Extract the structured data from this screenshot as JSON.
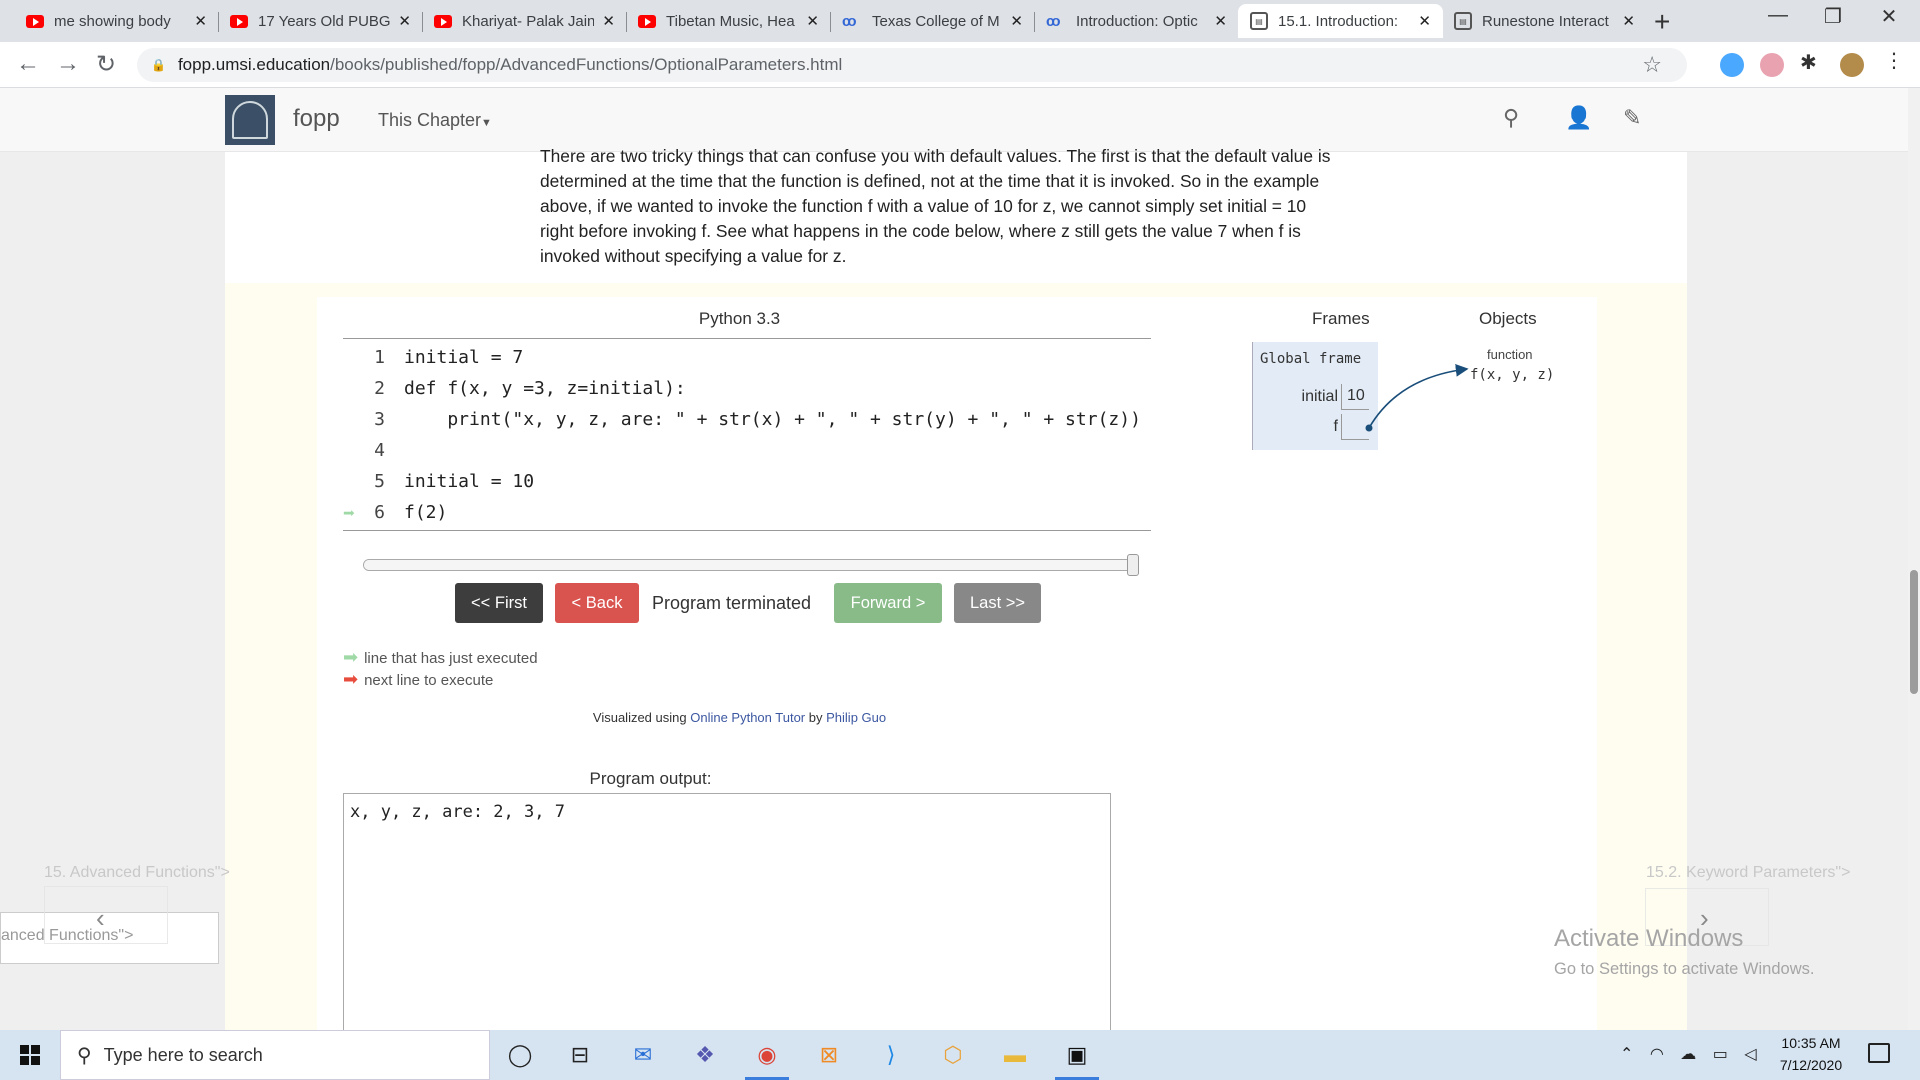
{
  "browser": {
    "tabs": [
      {
        "title": "me showing body",
        "icon": "youtube-icon"
      },
      {
        "title": "17 Years Old PUBG",
        "icon": "youtube-icon"
      },
      {
        "title": "Khariyat- Palak Jain",
        "icon": "youtube-icon"
      },
      {
        "title": "Tibetan Music, Hea",
        "icon": "youtube-icon"
      },
      {
        "title": "Texas College of M",
        "icon": "colab-icon"
      },
      {
        "title": "Introduction: Optic",
        "icon": "colab-icon"
      },
      {
        "title": "15.1. Introduction:",
        "icon": "document-icon",
        "active": true
      },
      {
        "title": "Runestone Interact",
        "icon": "document-icon"
      }
    ],
    "url_host": "fopp.umsi.education",
    "url_path": "/books/published/fopp/AdvancedFunctions/OptionalParameters.html",
    "new_tab": "+",
    "close_glyph": "✕"
  },
  "navbar": {
    "brand": "fopp",
    "chapter_menu": "This Chapter"
  },
  "intro_text": "There are two tricky things that can confuse you with default values. The first is that the default value is determined at the time that the function is defined, not at the time that it is invoked. So in the example above, if we wanted to invoke the function f with a value of 10 for z, we cannot simply set initial = 10 right before invoking f. See what happens in the code below, where z still gets the value 7 when f is invoked without specifying a value for z.",
  "visualizer": {
    "language": "Python 3.3",
    "code_lines": [
      {
        "n": "1",
        "text": "initial = 7"
      },
      {
        "n": "2",
        "text": "def f(x, y =3, z=initial):"
      },
      {
        "n": "3",
        "text": "    print(\"x, y, z, are: \" + str(x) + \", \" + str(y) + \", \" + str(z))"
      },
      {
        "n": "4",
        "text": ""
      },
      {
        "n": "5",
        "text": "initial = 10"
      },
      {
        "n": "6",
        "text": "f(2)",
        "just_executed": true
      }
    ],
    "step_progress": 1.0,
    "buttons": {
      "first": "<< First",
      "back": "< Back",
      "forward": "Forward >",
      "last": "Last >>"
    },
    "status": "Program terminated",
    "legend": {
      "just_executed": "line that has just executed",
      "next_line": "next line to execute",
      "just_executed_color": "#9ed9a6",
      "next_line_color": "#e74c3c"
    },
    "credits": {
      "prefix": "Visualized using",
      "tool": "Online Python Tutor",
      "by": "by",
      "author": "Philip Guo"
    },
    "output_label": "Program output:",
    "output_text": "x, y, z, are: 2, 3, 7",
    "frames_title": "Frames",
    "objects_title": "Objects",
    "global_frame": {
      "label": "Global frame",
      "vars": [
        {
          "name": "initial",
          "value": "10"
        },
        {
          "name": "f",
          "value": ""
        }
      ]
    },
    "function_object": {
      "kind": "function",
      "signature": "f(x, y, z)"
    }
  },
  "page_nav": {
    "prev_label": "15. Advanced Functions\">",
    "next_label": "15.2. Keyword Parameters\">",
    "prev_box_text": "anced Functions\">"
  },
  "watermark": {
    "title": "Activate Windows",
    "subtitle": "Go to Settings to activate Windows."
  },
  "taskbar": {
    "search_placeholder": "Type here to search",
    "time": "10:35 AM",
    "date": "7/12/2020"
  }
}
